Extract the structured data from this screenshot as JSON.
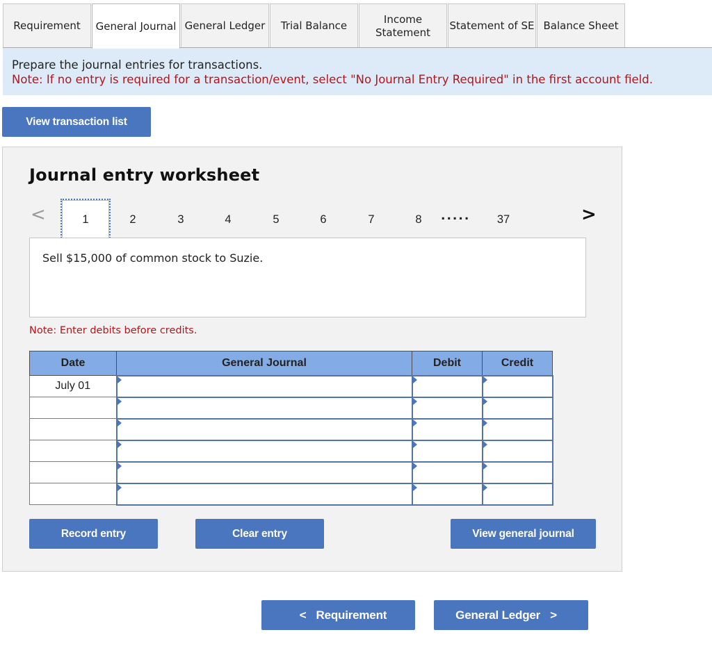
{
  "tabs": [
    {
      "label": "Requirement",
      "active": false
    },
    {
      "label": "General Journal",
      "active": true
    },
    {
      "label": "General Ledger",
      "active": false
    },
    {
      "label": "Trial Balance",
      "active": false
    },
    {
      "label": "Income Statement",
      "active": false
    },
    {
      "label": "Statement of SE",
      "active": false
    },
    {
      "label": "Balance Sheet",
      "active": false
    }
  ],
  "instructions": {
    "main": "Prepare the journal entries for transactions.",
    "note": "Note: If no entry is required for a transaction/event, select \"No Journal Entry Required\" in the first account field."
  },
  "view_transaction_list_label": "View transaction list",
  "worksheet": {
    "title": "Journal entry worksheet",
    "pager": {
      "prev_icon": "chevron-left-icon",
      "next_icon": "chevron-right-icon",
      "prev_glyph": "<",
      "next_glyph": ">",
      "pages": [
        "1",
        "2",
        "3",
        "4",
        "5",
        "6",
        "7",
        "8"
      ],
      "ellipsis": ".....",
      "last_page": "37",
      "current_page": "1"
    },
    "description": "Sell $15,000 of common stock to Suzie.",
    "note": "Note: Enter debits before credits.",
    "table": {
      "headers": {
        "date": "Date",
        "account": "General Journal",
        "debit": "Debit",
        "credit": "Credit"
      },
      "rows": [
        {
          "date": "July 01",
          "account": "",
          "debit": "",
          "credit": ""
        },
        {
          "date": "",
          "account": "",
          "debit": "",
          "credit": ""
        },
        {
          "date": "",
          "account": "",
          "debit": "",
          "credit": ""
        },
        {
          "date": "",
          "account": "",
          "debit": "",
          "credit": ""
        },
        {
          "date": "",
          "account": "",
          "debit": "",
          "credit": ""
        },
        {
          "date": "",
          "account": "",
          "debit": "",
          "credit": ""
        }
      ]
    },
    "buttons": {
      "record": "Record entry",
      "clear": "Clear entry",
      "view_general_journal": "View general journal"
    }
  },
  "navigation": {
    "prev_label": "Requirement",
    "next_label": "General Ledger",
    "prev_glyph": "<",
    "next_glyph": ">"
  },
  "colors": {
    "accent": "#4a76bf",
    "header_blue": "#83abe5",
    "note_red": "#b1161c",
    "instruction_bg": "#ddebf8"
  }
}
